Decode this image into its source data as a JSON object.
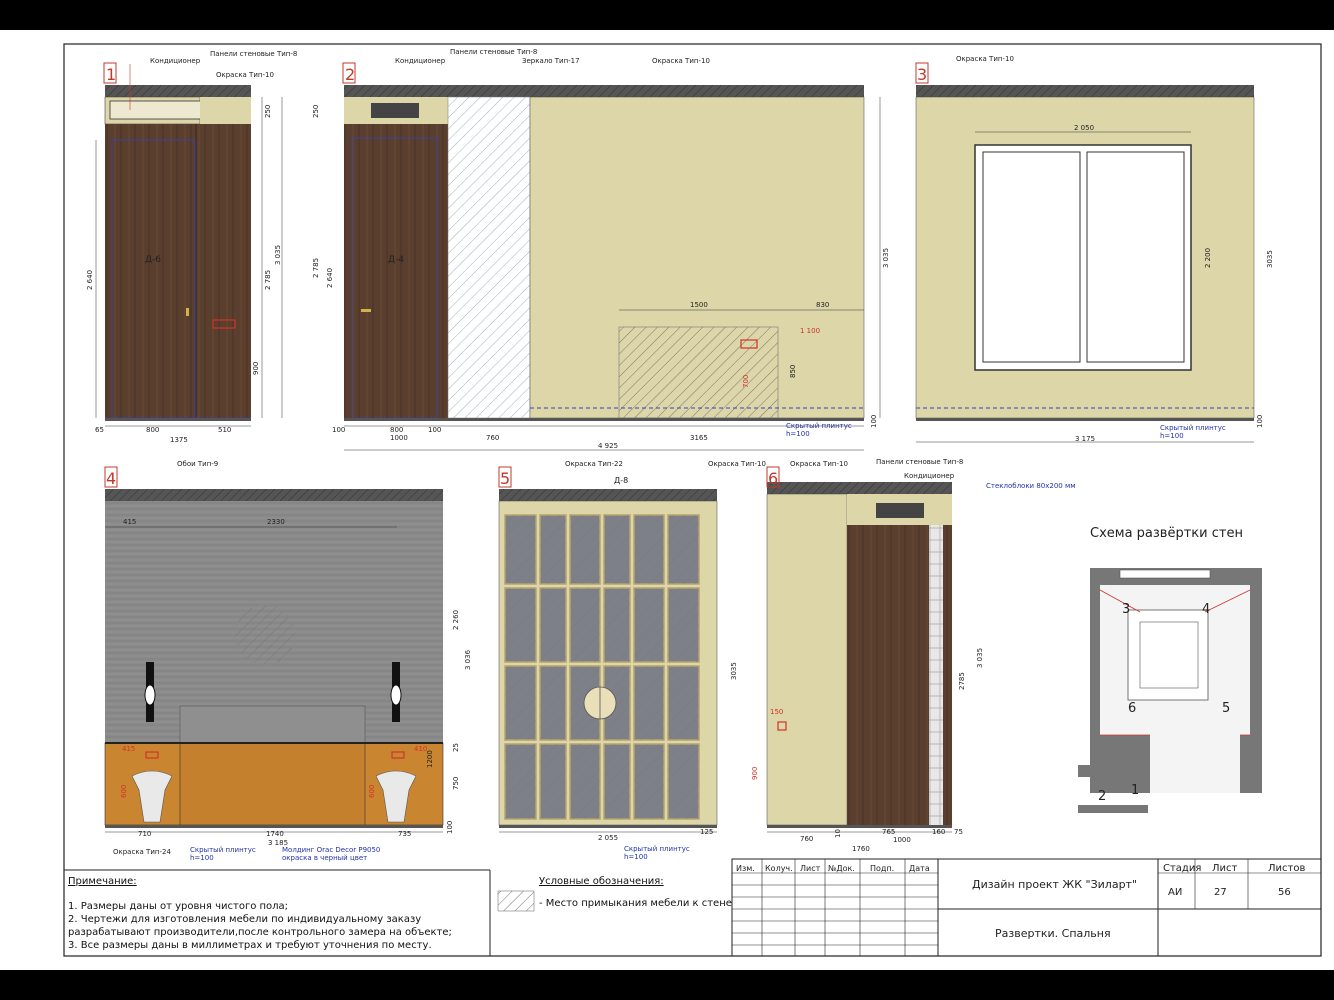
{
  "elevations": [
    {
      "id": "1",
      "labels": {
        "ac": "Кондиционер",
        "panels": "Панели стеновые Тип-8",
        "paint": "Окраска Тип-10",
        "door": "Д-6"
      },
      "dims": {
        "w1": "65",
        "w2": "800",
        "w3": "510",
        "total": "1375",
        "h_left": "2 640",
        "h_top": "250",
        "h_right": "2 785",
        "h_total": "3 035",
        "h_sock": "900"
      }
    },
    {
      "id": "2",
      "labels": {
        "ac": "Кондиционер",
        "panels": "Панели стеновые Тип-8",
        "mirror": "Зеркало Тип-17",
        "paint": "Окраска Тип-10",
        "door": "Д-4",
        "plinth": "Скрытый плинтус",
        "plinth_h": "h=100"
      },
      "dims": {
        "h_top": "250",
        "h_left": "2 785",
        "h_left2": "2 640",
        "w1": "100",
        "w2": "800",
        "w3": "100",
        "w4": "1000",
        "w5": "760",
        "w6": "4 925",
        "w7": "3165",
        "f1": "1500",
        "f2": "830",
        "f3": "1 100",
        "f4": "850",
        "f5": "700",
        "h_total": "3 035",
        "h_bot": "100"
      }
    },
    {
      "id": "3",
      "labels": {
        "paint": "Окраска Тип-10",
        "plinth": "Скрытый плинтус",
        "plinth_h": "h=100"
      },
      "dims": {
        "w_win": "2 050",
        "h_win": "2 200",
        "w_total": "3 175",
        "h_total": "3035",
        "h_bot": "100"
      }
    },
    {
      "id": "4",
      "labels": {
        "wall": "Обои Тип-9",
        "paint": "Окраска Тип-24",
        "plinth": "Скрытый плинтус",
        "plinth_h": "h=100",
        "molding": "Молдинг Orac Decor P9050",
        "molding2": "окраска в черный цвет"
      },
      "dims": {
        "d1": "415",
        "d2": "2330",
        "h1": "2 260",
        "h2": "3 036",
        "h3": "25",
        "h4": "1200",
        "h5": "750",
        "s1": "415",
        "s2": "410",
        "s3": "600",
        "s4": "600",
        "w1": "710",
        "w2": "1740",
        "w3": "735",
        "w_total": "3 185",
        "h_bot": "100"
      }
    },
    {
      "id": "5",
      "labels": {
        "paint22": "Окраска Тип-22",
        "paint10": "Окраска Тип-10",
        "door": "Д-8",
        "plinth": "Скрытый плинтус",
        "plinth_h": "h=100"
      },
      "dims": {
        "w_total": "2 055",
        "w2": "125",
        "h_total": "3035"
      }
    },
    {
      "id": "6",
      "labels": {
        "paint": "Окраска Тип-10",
        "panels": "Панели стеновые Тип-8",
        "ac": "Кондиционер",
        "glass": "Стеклоблоки 80х200 мм"
      },
      "dims": {
        "s1": "150",
        "s2": "900",
        "s3": "10",
        "w1": "760",
        "w2": "765",
        "w3": "160",
        "w4": "75",
        "w5": "1000",
        "w_total": "1760",
        "h1": "2785",
        "h2": "3 035"
      }
    }
  ],
  "scheme": {
    "title": "Схема развёртки стен",
    "marks": [
      "1",
      "2",
      "3",
      "4",
      "5",
      "6"
    ]
  },
  "notes": {
    "title": "Примечание:",
    "lines": [
      "1. Размеры даны от уровня чистого пола;",
      "2. Чертежи для изготовления мебели по индивидуальному заказу",
      "разрабатывают производители,после контрольного замера на объекте;",
      "3.  Все размеры даны в миллиметрах и требуют уточнения по месту."
    ]
  },
  "legend": {
    "title": "Условные обозначения:",
    "item": "- Место примыкания мебели к стене"
  },
  "titleblock": {
    "cols": [
      "Изм.",
      "Колуч.",
      "Лист",
      "№Док.",
      "Подп.",
      "Дата"
    ],
    "project": "Дизайн проект ЖК \"Зиларт\"",
    "sheet_name": "Развертки. Спальня",
    "stage_h": "Стадия",
    "sheet_h": "Лист",
    "sheets_h": "Листов",
    "stage": "АИ",
    "sheet": "27",
    "sheets": "56"
  },
  "colors": {
    "wood": "#5a3e2e",
    "beige": "#ddd6a8",
    "grey": "#8a8a8a",
    "orange": "#c9852f",
    "red": "#d0342c",
    "blue": "#3344bb"
  }
}
